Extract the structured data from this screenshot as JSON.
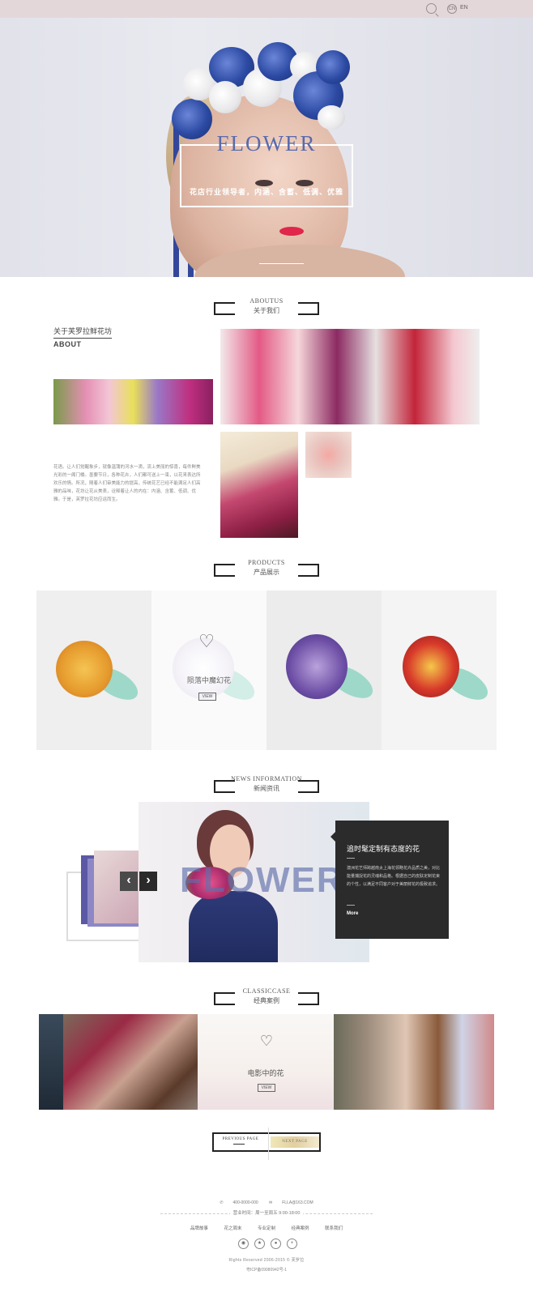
{
  "topbar": {
    "lang_cn": "CN",
    "lang_en": "EN"
  },
  "hero": {
    "title": "FLOWER",
    "subtitle": "花店行业领导者，内涵、含蓄、低调、优雅"
  },
  "about": {
    "section_en": "ABOUTUS",
    "section_cn": "关于我们",
    "title": "关于芙罗拉鲜花坊",
    "title_en": "ABOUT",
    "text": "花语。让人们觉醒象步，就像温蒲的河水一滴，流上美丽的惊喜，每件鲜美光彩的一阁门楼。墨要节日，各种花卉，人们都可送上一束，以花来表达所欢乐的情。所况，随着人们审美能力的提高，传统花艺已经不能满足人们高雅的品味，花坊让花从美表，诠释着让人的内在：内涵、含蓄、低调、优雅。于是，芙罗拉花坊应运而生。"
  },
  "products": {
    "section_en": "PRODUCTS",
    "section_cn": "产品展示",
    "items": [
      {
        "name": "",
        "view": ""
      },
      {
        "name": "陨落中魔幻花",
        "view": "VIEW"
      },
      {
        "name": "",
        "view": ""
      },
      {
        "name": "",
        "view": ""
      }
    ]
  },
  "news": {
    "section_en": "NEWS INFORMATION",
    "section_cn": "新闻资讯",
    "overlay_word": "FLOWER",
    "prev": "‹",
    "next": "›",
    "title": "追时髦定制有态度的花",
    "text": "澳洲花艺师跨越南太上海花领略花卉品质之美，对比能量捕捉花的灵魂和品格。根据自己的皮肤定制花束的个性，以满足不同客户对于美丽鲜花的极致追求。",
    "more": "More"
  },
  "cases": {
    "section_en": "CLASSICCASE",
    "section_cn": "经典案例",
    "featured_name": "电影中的花",
    "view": "VIEW"
  },
  "pager": {
    "prev": "PREVIOUS PAGE",
    "next": "NEXT PAGE"
  },
  "footer": {
    "phone": "400-0000-000",
    "email": "FLLA@163.COM",
    "hours": "营业时间：周一至周五 9:00-18:00",
    "nav": [
      "品牌故事",
      "花之周末",
      "专业定制",
      "经典案例",
      "联系我们"
    ],
    "icons": [
      "weibo-icon",
      "qzone-icon",
      "wechat-icon",
      "plus-icon"
    ],
    "copyright": "Rights Reserved 2006-2015 © 芙罗拉",
    "icp": "粤ICP备09080942号-1"
  }
}
